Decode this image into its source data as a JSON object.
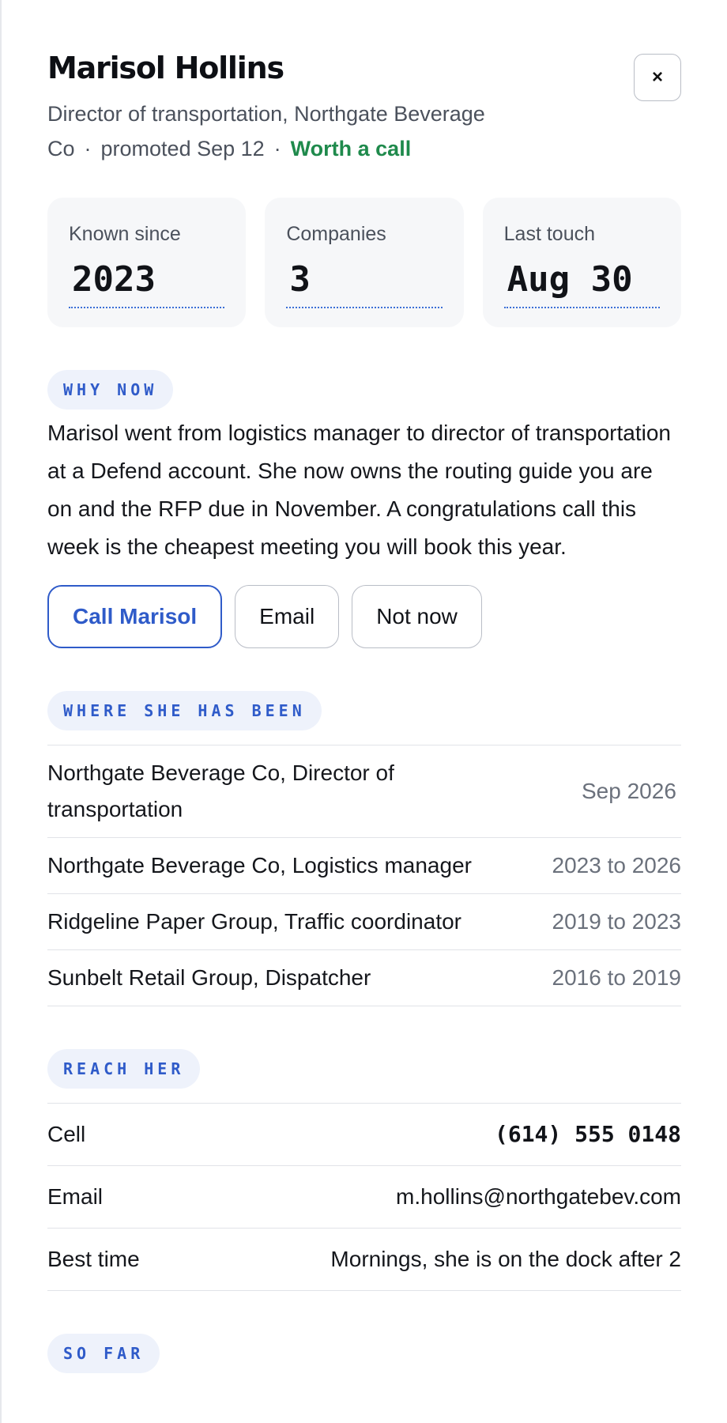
{
  "profile": {
    "name": "Marisol Hollins",
    "title": "Director of transportation, Northgate Beverage Co",
    "promoted": "promoted Sep 12",
    "status": "Worth a call",
    "close_label": "×"
  },
  "stats": [
    {
      "label": "Known since",
      "value": "2023"
    },
    {
      "label": "Companies",
      "value": "3"
    },
    {
      "label": "Last touch",
      "value": "Aug 30"
    }
  ],
  "why_now": {
    "label": "WHY NOW",
    "body": "Marisol went from logistics manager to director of transportation at a Defend account. She now owns the routing guide you are on and the RFP due in November. A congratulations call this week is the cheapest meeting you will book this year."
  },
  "actions": {
    "call": "Call Marisol",
    "email": "Email",
    "not_now": "Not now"
  },
  "history": {
    "label": "WHERE SHE HAS BEEN",
    "rows": [
      {
        "role": "Northgate Beverage Co, Director of transportation",
        "period": "Sep 2026"
      },
      {
        "role": "Northgate Beverage Co, Logistics manager",
        "period": "2023 to 2026"
      },
      {
        "role": "Ridgeline Paper Group, Traffic coordinator",
        "period": "2019 to 2023"
      },
      {
        "role": "Sunbelt Retail Group, Dispatcher",
        "period": "2016 to 2019"
      }
    ]
  },
  "reach": {
    "label": "REACH HER",
    "rows": [
      {
        "label": "Cell",
        "value": "(614) 555 0148"
      },
      {
        "label": "Email",
        "value": "m.hollins@northgatebev.com"
      },
      {
        "label": "Best time",
        "value": "Mornings, she is on the dock after 2"
      }
    ]
  },
  "next_section": {
    "label": "SO FAR"
  },
  "colors": {
    "accent": "#2f5bc9",
    "status_green": "#1f8a4c",
    "pill_bg": "#eef2fb",
    "stat_bg": "#f6f7f9"
  },
  "icons": {
    "close": "close-icon"
  }
}
